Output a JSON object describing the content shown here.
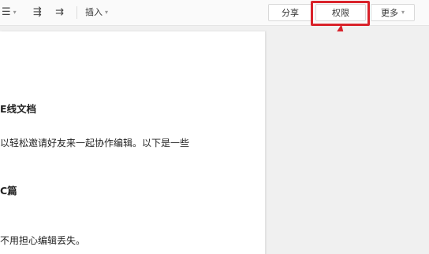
{
  "toolbar": {
    "align_icon": "align-icon",
    "align_glyph": "☰",
    "indent_icon": "indent-icon",
    "indent_glyph": "⇶",
    "outdent_icon": "outdent-icon",
    "outdent_glyph": "⇉",
    "insert_label": "插入",
    "caret": "▾"
  },
  "actions": {
    "share_label": "分享",
    "permission_label": "权限",
    "more_label": "更多"
  },
  "annotation": {
    "highlight_color": "#d9232b"
  },
  "document": {
    "heading1": "E线文档",
    "paragraph1": "以轻松邀请好友来一起协作编辑。以下是一些",
    "heading2": "C篇",
    "paragraph2": "不用担心编辑丢失。"
  }
}
